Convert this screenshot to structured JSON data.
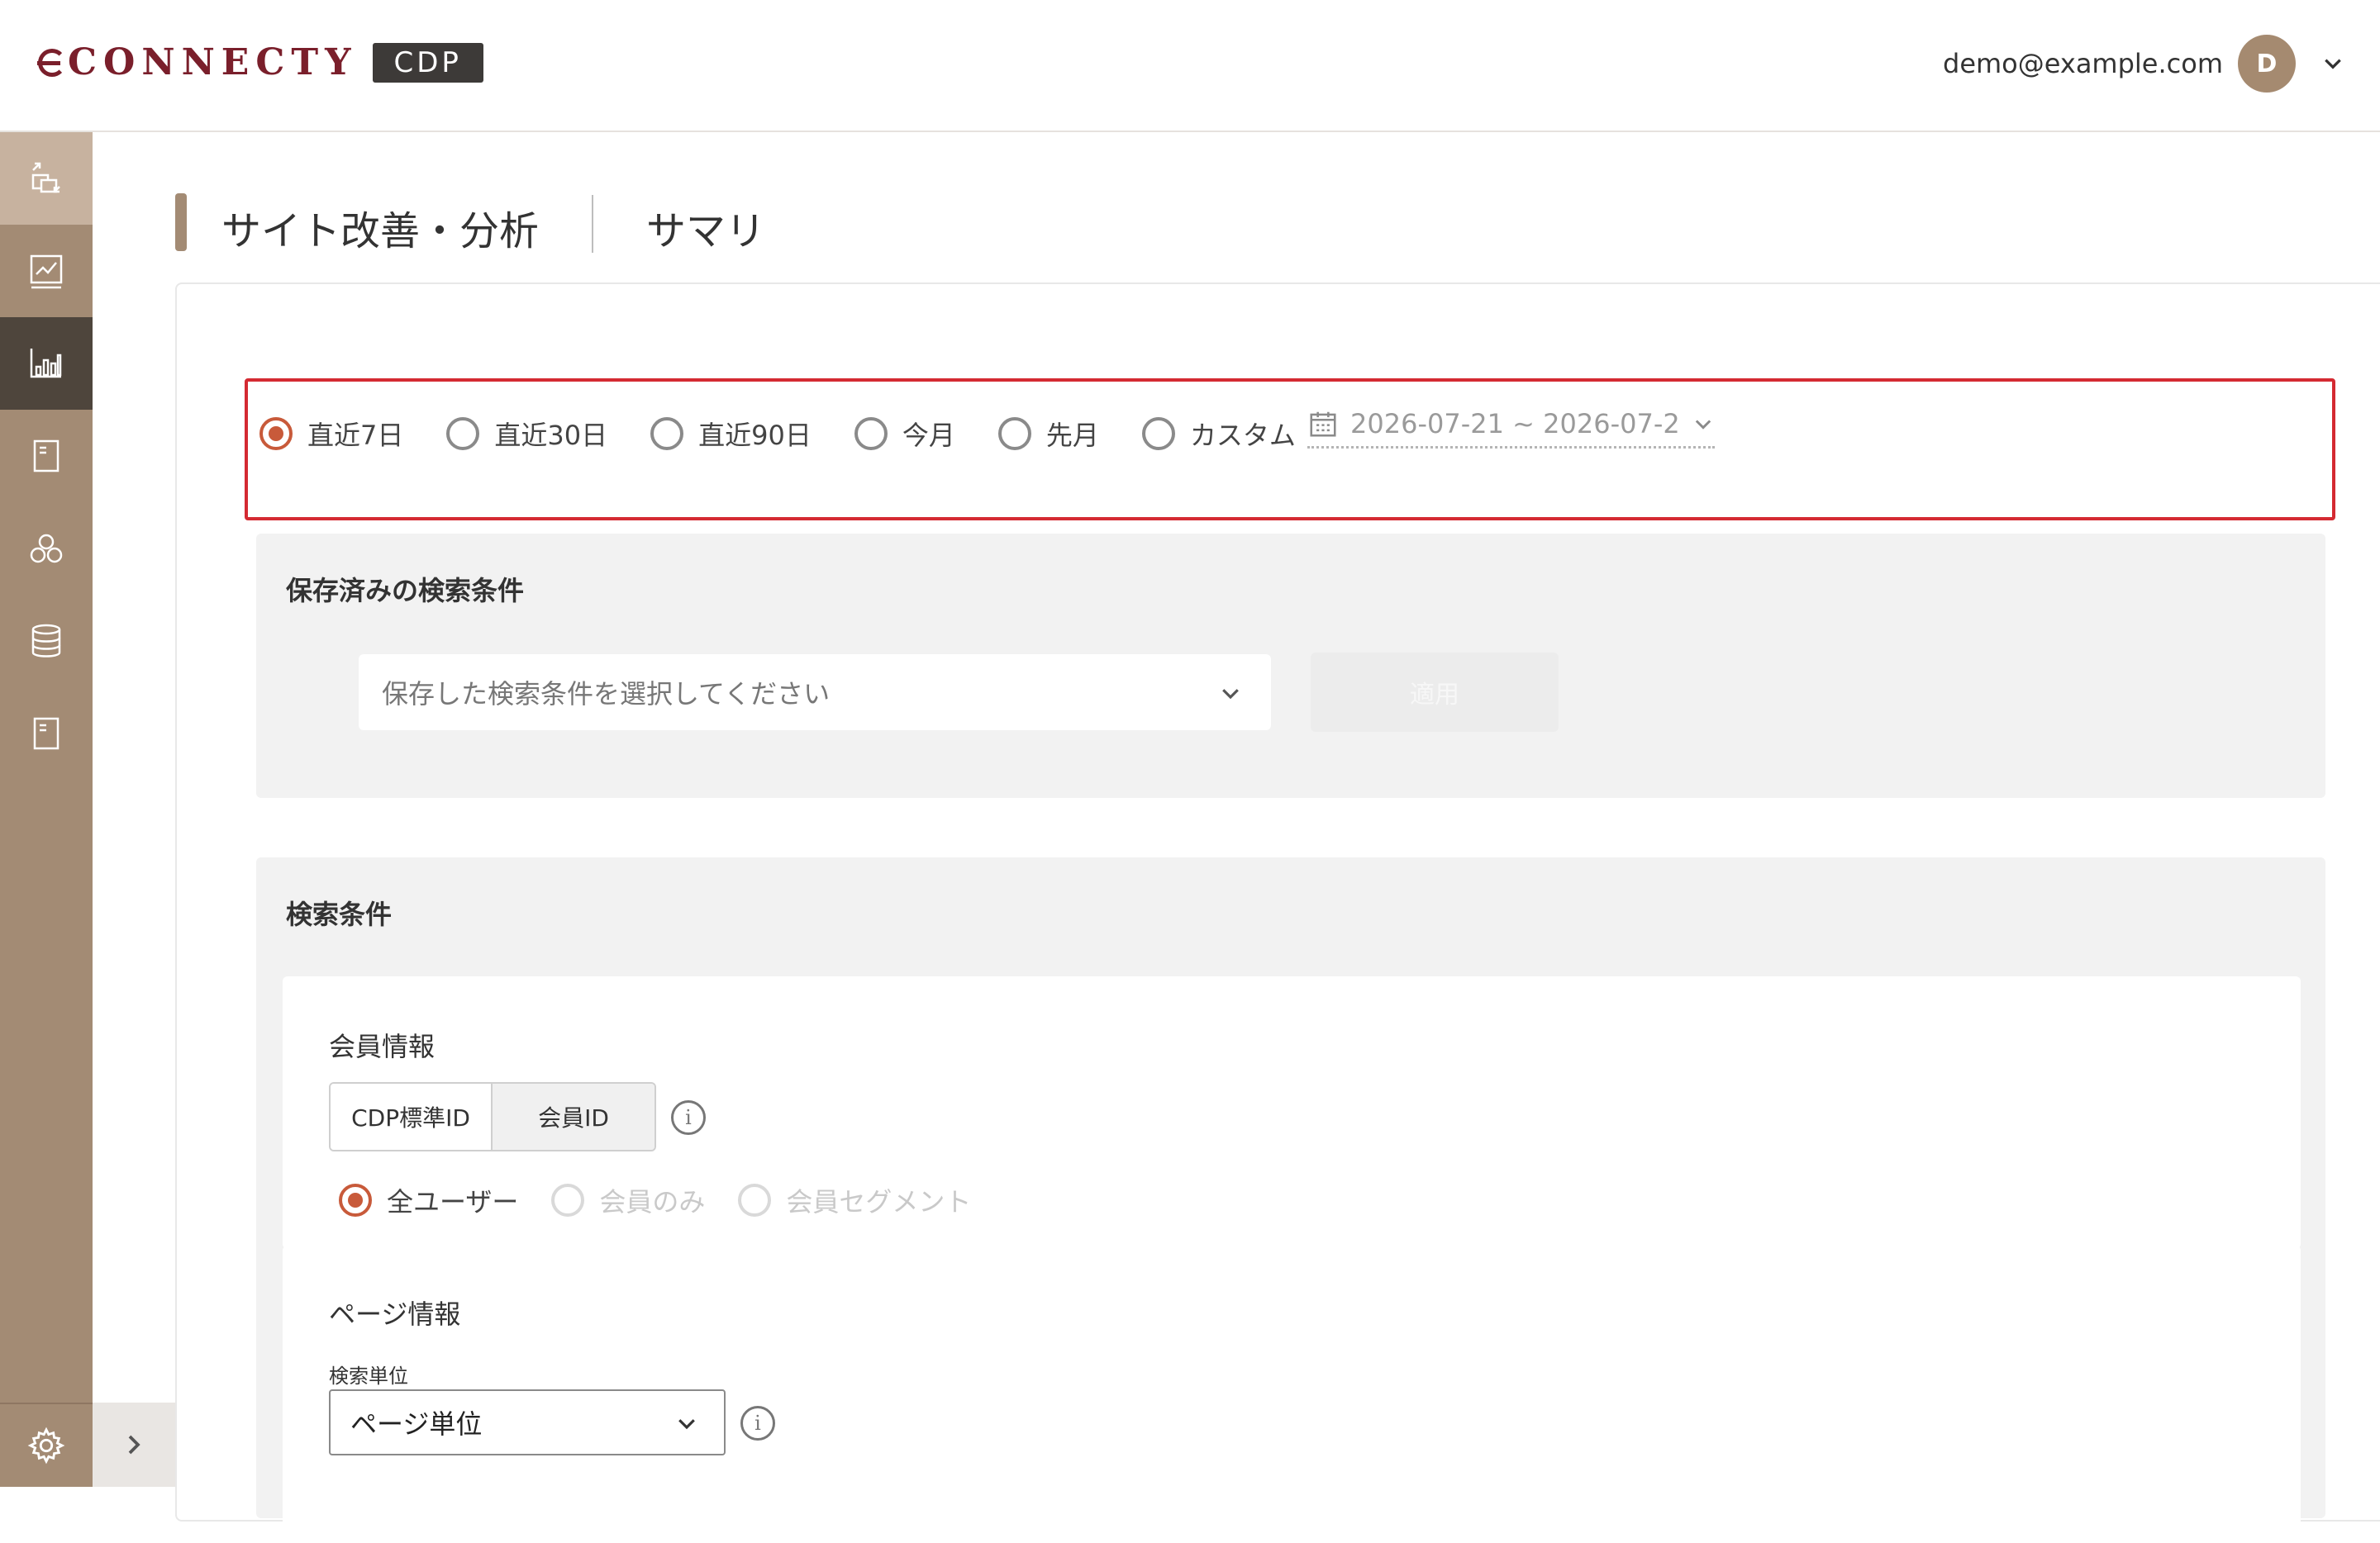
{
  "header": {
    "logo_text": "CONNECTY",
    "logo_badge": "CDP",
    "user_email": "demo@example.com",
    "avatar_initial": "D"
  },
  "sidebar": {
    "items": [
      {
        "icon": "data-transfer-icon"
      },
      {
        "icon": "line-chart-icon"
      },
      {
        "icon": "bar-chart-icon",
        "active": true
      },
      {
        "icon": "document-icon"
      },
      {
        "icon": "segments-icon"
      },
      {
        "icon": "database-icon"
      },
      {
        "icon": "document-icon"
      }
    ],
    "footer_icon": "gear-icon"
  },
  "page": {
    "title": "サイト改善・分析",
    "subtitle": "サマリ"
  },
  "period": {
    "options": [
      "直近7日",
      "直近30日",
      "直近90日",
      "今月",
      "先月",
      "カスタム"
    ],
    "selected": "直近7日",
    "date_range": "2026-07-21 ~ 2026-07-2"
  },
  "saved_conditions": {
    "title": "保存済みの検索条件",
    "placeholder": "保存した検索条件を選択してください",
    "button_label": "適用"
  },
  "search_conditions": {
    "title": "検索条件",
    "member_info": {
      "title": "会員情報",
      "toggle": [
        "CDP標準ID",
        "会員ID"
      ],
      "toggle_selected": "CDP標準ID",
      "user_options": [
        "全ユーザー",
        "会員のみ",
        "会員セグメント"
      ],
      "user_selected": "全ユーザー"
    },
    "page_info": {
      "title": "ページ情報",
      "unit_label": "検索単位",
      "unit_value": "ページ単位"
    }
  },
  "colors": {
    "brand": "#7a1f2b",
    "sidebar": "#a38b74",
    "accent_radio": "#c85a3a",
    "highlight_border": "#d42a32"
  }
}
